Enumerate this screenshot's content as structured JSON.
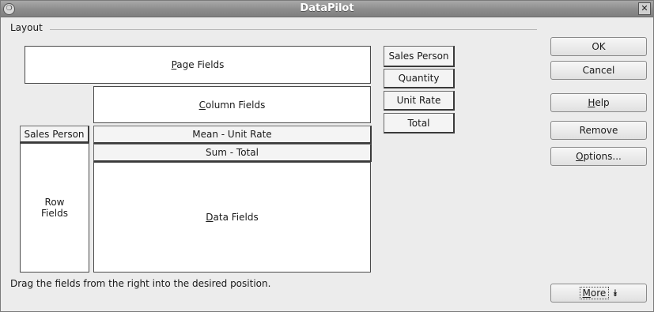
{
  "window": {
    "title": "DataPilot",
    "menu_glyph": "❍",
    "close_glyph": "✕"
  },
  "layout": {
    "label": "Layout",
    "page_fields": {
      "mnemonic": "P",
      "rest": "age Fields"
    },
    "column_fields": {
      "mnemonic": "C",
      "rest": "olumn Fields"
    },
    "row_fields": {
      "line1": "Row",
      "line2": "Fields"
    },
    "data_fields": {
      "mnemonic": "D",
      "rest": "ata Fields"
    },
    "row_field_button": "Sales Person",
    "data_field_buttons": [
      "Mean - Unit Rate",
      "Sum - Total"
    ],
    "available_fields": [
      "Sales Person",
      "Quantity",
      "Unit Rate",
      "Total"
    ]
  },
  "buttons": {
    "ok": "OK",
    "cancel": "Cancel",
    "help": {
      "mnemonic": "H",
      "rest": "elp"
    },
    "remove": "Remove",
    "options": {
      "mnemonic": "O",
      "rest": "ptions..."
    },
    "more": {
      "mnemonic": "M",
      "rest": "ore",
      "arrow": "⯯"
    }
  },
  "hint": "Drag the fields from the right into the desired position."
}
